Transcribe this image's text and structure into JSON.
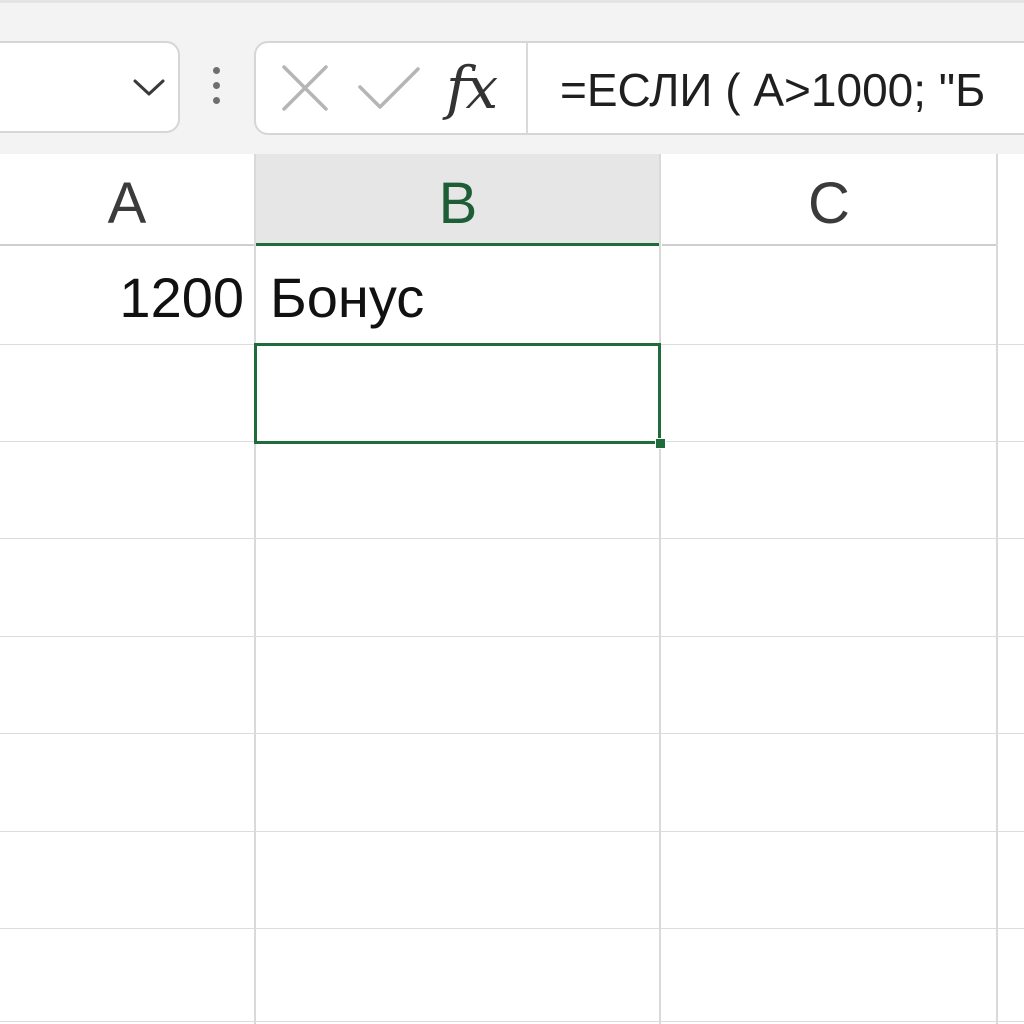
{
  "name_box": {
    "value": ""
  },
  "formula_bar": {
    "cancel_icon": "close-icon",
    "enter_icon": "check-icon",
    "fx_label": "fx",
    "formula": "=ЕСЛИ ( A>1000; \"Б"
  },
  "grid": {
    "columns": [
      {
        "label": "A",
        "selected": false
      },
      {
        "label": "B",
        "selected": true
      },
      {
        "label": "C",
        "selected": false
      }
    ],
    "cells": {
      "A1": "1200",
      "B1": "Бонус"
    },
    "active_cell": "B2"
  },
  "colors": {
    "accent": "#1f6b3c",
    "header_selected_bg": "#e6e6e6",
    "gridline": "#dcdcdc"
  }
}
